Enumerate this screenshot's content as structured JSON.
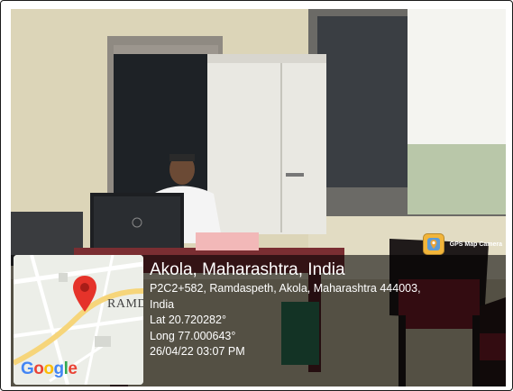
{
  "badge": {
    "label": "GPS Map Camera",
    "icon": "map-pin-app-icon"
  },
  "location": {
    "place": "Akola, Maharashtra, India",
    "address_line1": "P2C2+582, Ramdaspeth, Akola, Maharashtra 444003,",
    "address_line2": "India",
    "lat": "Lat 20.720282°",
    "long": "Long 77.000643°",
    "datetime": "26/04/22 03:07 PM"
  },
  "map": {
    "area_label": "RAMD",
    "logo_text": "Google",
    "pin_color": "#e5332a"
  }
}
